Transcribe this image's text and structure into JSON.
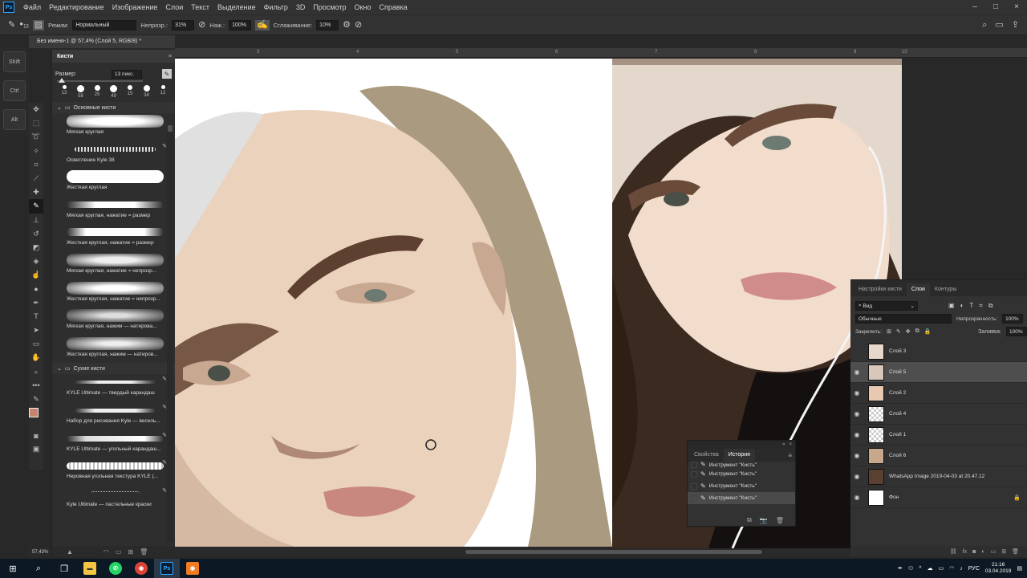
{
  "menubar": {
    "items": [
      "Файл",
      "Редактирование",
      "Изображение",
      "Слои",
      "Текст",
      "Выделение",
      "Фильтр",
      "3D",
      "Просмотр",
      "Окно",
      "Справка"
    ],
    "window_controls": [
      "–",
      "□",
      "×"
    ]
  },
  "options": {
    "brush_size": "13",
    "mode_label": "Режим:",
    "mode_value": "Нормальный",
    "opacity_label": "Непрозр.:",
    "opacity_value": "31%",
    "pressure_label": "Наж.:",
    "pressure_value": "100%",
    "smoothing_label": "Сглаживание:",
    "smoothing_value": "10%"
  },
  "document": {
    "tab_title": "Без имени-1 @ 57,4% (Слой 5, RGB/8) *",
    "zoom": "57,43%",
    "ruler_labels": [
      "3",
      "4",
      "5",
      "6",
      "7",
      "8",
      "9",
      "10"
    ]
  },
  "modifier_keys": [
    "Shift",
    "Ctrl",
    "Alt"
  ],
  "brushes_panel": {
    "title": "Кисти",
    "size_label": "Размер:",
    "size_value": "13 пикс.",
    "presets": [
      "13",
      "58",
      "25",
      "49",
      "15",
      "34",
      "12"
    ],
    "groups": [
      {
        "name": "Основные кисти",
        "items": [
          "Мягкая круглая",
          "Осветление Kyle 38",
          "Жесткая круглая",
          "Мягкая круглая, нажатие = размер",
          "Жесткая круглая, нажатие = размер",
          "Мягкая круглая, нажатие = непрозр...",
          "Жесткая круглая, нажатие = непрозр...",
          "Мягкая круглая, нажим — натирова...",
          "Жесткая круглая, нажим — натиров..."
        ]
      },
      {
        "name": "Сухие кисти",
        "items": [
          "KYLE Ultimate — твердый карандаш",
          "Набор для рисования Kyle — весель...",
          "KYLE Ultimate — угольный карандаш...",
          "Неровная угольная текстура KYLE (...",
          "Kyle Ultimate — пастельные краски"
        ]
      }
    ]
  },
  "layers_panel": {
    "tabs": [
      "Настройки кисти",
      "Слои",
      "Контуры"
    ],
    "active_tab": "Слои",
    "filter_value": "Вид",
    "blend_mode": "Обычные",
    "opacity_label": "Непрозрачность:",
    "opacity_value": "100%",
    "lock_label": "Закрепить:",
    "fill_label": "Заливка:",
    "fill_value": "100%",
    "layers": [
      {
        "name": "Слой 3",
        "visible": false,
        "selected": false
      },
      {
        "name": "Слой 5",
        "visible": true,
        "selected": true
      },
      {
        "name": "Слой 2",
        "visible": true,
        "selected": false
      },
      {
        "name": "Слой 4",
        "visible": true,
        "selected": false
      },
      {
        "name": "Слой 1",
        "visible": true,
        "selected": false
      },
      {
        "name": "Слой 6",
        "visible": true,
        "selected": false
      },
      {
        "name": "WhatsApp Image 2019-04-03 at 20.47.12",
        "visible": true,
        "selected": false
      },
      {
        "name": "Фон",
        "visible": true,
        "selected": false,
        "locked": true
      }
    ]
  },
  "history_panel": {
    "tabs": [
      "Свойства",
      "История"
    ],
    "active_tab": "История",
    "items": [
      "Инструмент \"Кисть\"",
      "Инструмент \"Кисть\"",
      "Инструмент \"Кисть\"",
      "Инструмент \"Кисть\""
    ]
  },
  "taskbar": {
    "language": "РУС",
    "time": "21:16",
    "date": "03.04.2019"
  }
}
